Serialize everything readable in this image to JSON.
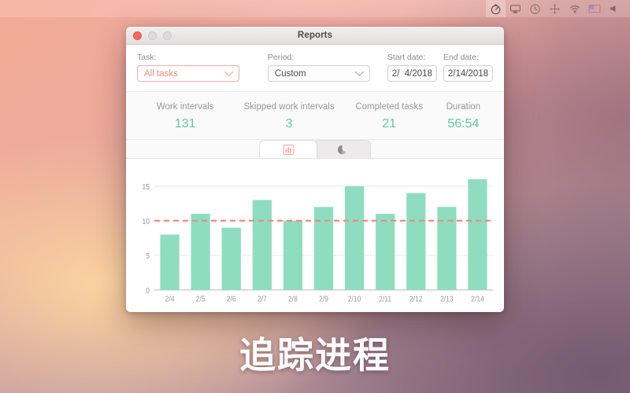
{
  "menubar": {
    "icons": [
      {
        "name": "timer-icon",
        "label": "Timer",
        "active": true
      },
      {
        "name": "airplay-icon",
        "label": "AirPlay",
        "active": false
      },
      {
        "name": "clock-icon",
        "label": "Clock",
        "active": false
      },
      {
        "name": "move-icon",
        "label": "Move",
        "active": false
      },
      {
        "name": "wifi-icon",
        "label": "Wi-Fi",
        "active": false
      },
      {
        "name": "flag-icon",
        "label": "Input source",
        "active": false
      },
      {
        "name": "volume-icon",
        "label": "Volume",
        "active": false
      }
    ]
  },
  "window": {
    "title": "Reports",
    "traffic_lights": {
      "close": "close",
      "minimize": "minimize",
      "maximize": "maximize"
    }
  },
  "filters": {
    "task": {
      "label": "Task:",
      "value": "All tasks",
      "options": [
        "All tasks"
      ]
    },
    "period": {
      "label": "Period:",
      "value": "Custom",
      "options": [
        "Custom"
      ]
    },
    "start_date": {
      "label": "Start date:",
      "value": "2/  4/2018"
    },
    "end_date": {
      "label": "End date:",
      "value": "2/14/2018"
    }
  },
  "stats": [
    {
      "label": "Work intervals",
      "value": "131"
    },
    {
      "label": "Skipped work intervals",
      "value": "3"
    },
    {
      "label": "Completed tasks",
      "value": "21"
    },
    {
      "label": "Duration",
      "value": "56:54"
    }
  ],
  "tabs": [
    {
      "name": "tab-bar-chart",
      "icon": "bar-chart-icon",
      "active": true
    },
    {
      "name": "tab-pie-chart",
      "icon": "pie-chart-icon",
      "active": false
    }
  ],
  "colors": {
    "bar": "#8fddc0",
    "goal_line": "#f2887a",
    "accent": "#ef8c7c",
    "stat_value": "#62c9a4",
    "axis_text": "#9a9898"
  },
  "caption": "追踪进程",
  "chart_data": {
    "type": "bar",
    "title": "",
    "xlabel": "",
    "ylabel": "",
    "categories": [
      "2/4",
      "2/5",
      "2/6",
      "2/7",
      "2/8",
      "2/9",
      "2/10",
      "2/11",
      "2/12",
      "2/13",
      "2/14"
    ],
    "values": [
      8,
      11,
      9,
      13,
      10,
      12,
      15,
      11,
      14,
      12,
      16
    ],
    "series": [
      {
        "name": "Work intervals",
        "values": [
          8,
          11,
          9,
          13,
          10,
          12,
          15,
          11,
          14,
          12,
          16
        ]
      }
    ],
    "ylim": [
      0,
      17
    ],
    "yticks": [
      0,
      5,
      10,
      15
    ],
    "ytick_labels": [
      "0",
      "5",
      "10",
      "15"
    ],
    "grid": true,
    "legend": "none",
    "goal_line": {
      "value": 10,
      "style": "dashed",
      "label": ""
    },
    "bar_color": "#8fddc0"
  }
}
